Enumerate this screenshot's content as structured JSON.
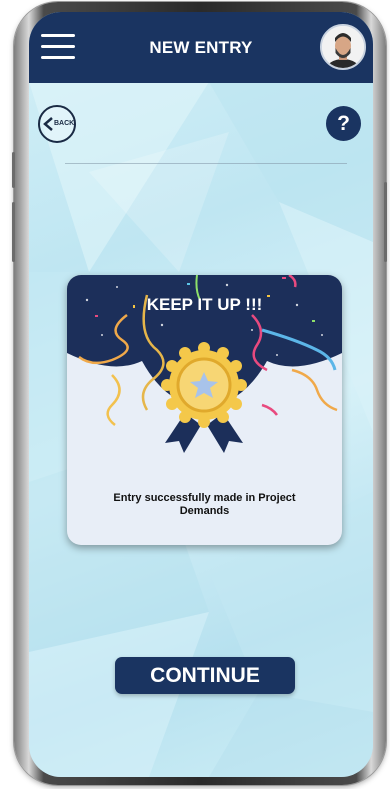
{
  "header": {
    "title": "NEW ENTRY",
    "menu_icon": "hamburger-menu-icon",
    "avatar_icon": "user-avatar-icon"
  },
  "nav": {
    "back_label": "BACK",
    "help_label": "?"
  },
  "card": {
    "title": "KEEP IT UP !!!",
    "message": "Entry successfully made in Project Demands",
    "badge_icon": "star-medal-badge-icon"
  },
  "actions": {
    "continue_label": "CONTINUE"
  },
  "colors": {
    "primary_navy": "#1a3461",
    "background_light_blue": "#c8ebf5",
    "card_background": "#e8eef7",
    "medal_gold": "#f5c542",
    "star_blue": "#a8c3ea"
  }
}
